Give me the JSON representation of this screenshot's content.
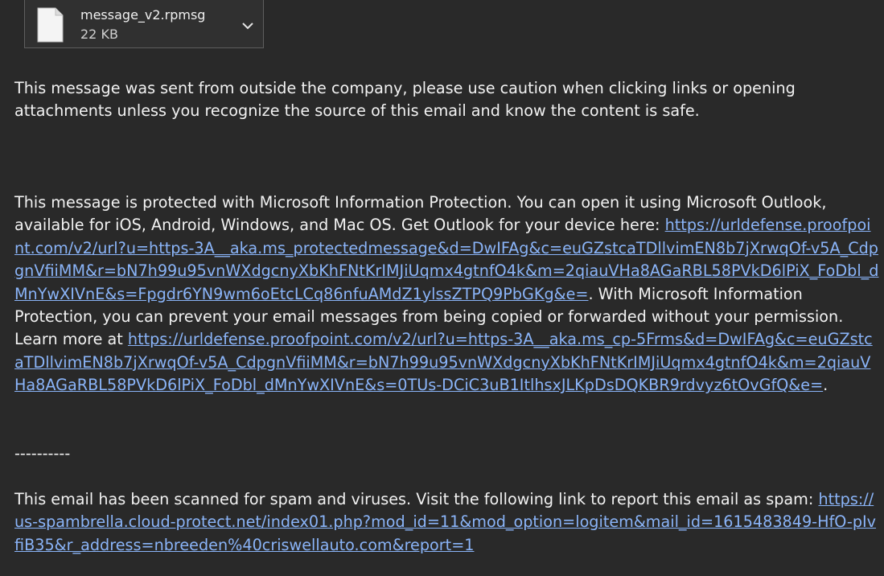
{
  "attachment": {
    "filename": "message_v2.rpmsg",
    "size": "22 KB",
    "icon": "file-icon",
    "dropdown_icon": "chevron-down-icon"
  },
  "warning": {
    "text": "This message was sent from outside the company, please use caution when clicking links or opening attachments unless you recognize the source of this email and know the content is safe."
  },
  "mip": {
    "text_1": "This message is protected with Microsoft Information Protection. You can open it using Microsoft Outlook, available for iOS, Android, Windows, and Mac OS. Get Outlook for your device here: ",
    "link_1": "https://urldefense.proofpoint.com/v2/url?u=https-3A__aka.ms_protectedmessage&d=DwIFAg&c=euGZstcaTDllvimEN8b7jXrwqOf-v5A_CdpgnVfiiMM&r=bN7h99u95vnWXdgcnyXbKhFNtKrIMJiUqmx4gtnfO4k&m=2qiauVHa8AGaRBL58PVkD6lPiX_FoDbl_dMnYwXIVnE&s=Fpgdr6YN9wm6oEtcLCq86nfuAMdZ1ylssZTPQ9PbGKg&e=",
    "text_2": ". With Microsoft Information Protection, you can prevent your email messages from being copied or forwarded without your permission. Learn more at ",
    "link_2": "https://urldefense.proofpoint.com/v2/url?u=https-3A__aka.ms_cp-5Frms&d=DwIFAg&c=euGZstcaTDllvimEN8b7jXrwqOf-v5A_CdpgnVfiiMM&r=bN7h99u95vnWXdgcnyXbKhFNtKrIMJiUqmx4gtnfO4k&m=2qiauVHa8AGaRBL58PVkD6lPiX_FoDbl_dMnYwXIVnE&s=0TUs-DCiC3uB1ItlhsxJLKpDsDQKBR9rdvyz6tOvGfQ&e=",
    "text_3": "."
  },
  "separator": "----------",
  "spam": {
    "text": "This email has been scanned for spam and viruses. Visit the following link to report this email as spam: ",
    "link": "https://us-spambrella.cloud-protect.net/index01.php?mod_id=11&mod_option=logitem&mail_id=1615483849-HfO-pIvfiB35&r_address=nbreeden%40criswellauto.com&report=1"
  },
  "colors": {
    "background": "#292929",
    "text": "#f2f2f2",
    "link": "#8ab4f8"
  }
}
